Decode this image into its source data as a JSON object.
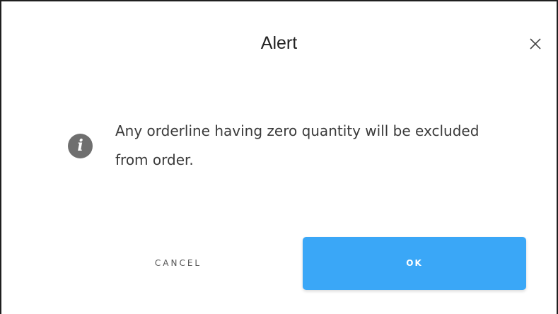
{
  "dialog": {
    "title": "Alert",
    "close_icon": "close-icon",
    "info_icon": "info-icon",
    "info_glyph": "i",
    "message": "Any orderline having zero quantity will be excluded from order.",
    "cancel_label": "CANCEL",
    "ok_label": "OK"
  },
  "colors": {
    "accent": "#3aa7f7",
    "icon": "#6f6f6f",
    "text": "#3a3a3a"
  }
}
